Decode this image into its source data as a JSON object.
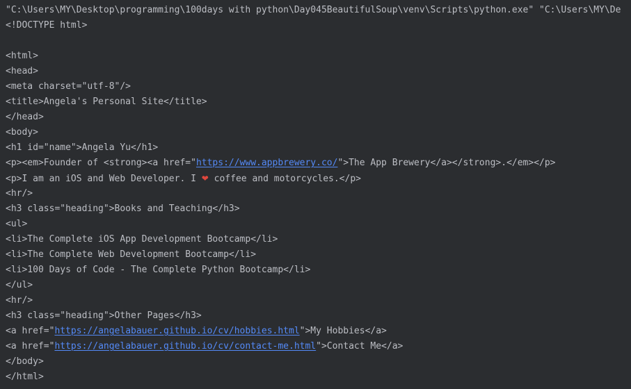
{
  "console": {
    "command": "\"C:\\Users\\MY\\Desktop\\programming\\100days with python\\Day045BeautifulSoup\\venv\\Scripts\\python.exe\" \"C:\\Users\\MY\\De",
    "lines": [
      {
        "pre": "<!DOCTYPE html>"
      },
      {
        "pre": ""
      },
      {
        "pre": "<html>"
      },
      {
        "pre": "<head>"
      },
      {
        "pre": "<meta charset=\"utf-8\"/>"
      },
      {
        "pre": "<title>Angela's Personal Site</title>"
      },
      {
        "pre": "</head>"
      },
      {
        "pre": "<body>"
      },
      {
        "pre": "<h1 id=\"name\">Angela Yu</h1>"
      },
      {
        "pre": "<p><em>Founder of <strong><a href=\"",
        "link": "https://www.appbrewery.co/",
        "post": "\">The App Brewery</a></strong>.</em></p>"
      },
      {
        "pre": "<p>I am an iOS and Web Developer. I ",
        "emoji": "❤",
        "post": " coffee and motorcycles.</p>"
      },
      {
        "pre": "<hr/>"
      },
      {
        "pre": "<h3 class=\"heading\">Books and Teaching</h3>"
      },
      {
        "pre": "<ul>"
      },
      {
        "pre": "<li>The Complete iOS App Development Bootcamp</li>"
      },
      {
        "pre": "<li>The Complete Web Development Bootcamp</li>"
      },
      {
        "pre": "<li>100 Days of Code - The Complete Python Bootcamp</li>"
      },
      {
        "pre": "</ul>"
      },
      {
        "pre": "<hr/>"
      },
      {
        "pre": "<h3 class=\"heading\">Other Pages</h3>"
      },
      {
        "pre": "<a href=\"",
        "link": "https://angelabauer.github.io/cv/hobbies.html",
        "post": "\">My Hobbies</a>"
      },
      {
        "pre": "<a href=\"",
        "link": "https://angelabauer.github.io/cv/contact-me.html",
        "post": "\">Contact Me</a>"
      },
      {
        "pre": "</body>"
      },
      {
        "pre": "</html>"
      }
    ]
  },
  "colors": {
    "background": "#2b2d30",
    "text": "#bcbec4",
    "link": "#548af7",
    "heart": "#e0473d"
  }
}
